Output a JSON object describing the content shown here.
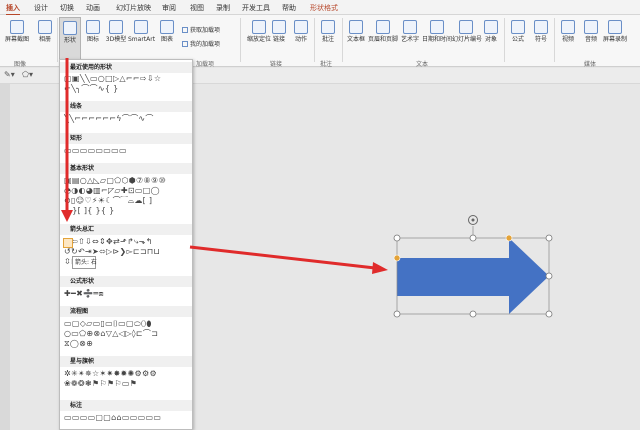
{
  "tabs": [
    "插入",
    "设计",
    "切换",
    "动画",
    "幻灯片放映",
    "审阅",
    "视图",
    "录制",
    "开发工具",
    "帮助",
    "形状格式"
  ],
  "ribbon": {
    "buttons": [
      {
        "label": "屏幕截图"
      },
      {
        "label": "相册"
      },
      {
        "label": "形状"
      },
      {
        "label": "图标"
      },
      {
        "label": "3D模型"
      },
      {
        "label": "SmartArt"
      },
      {
        "label": "图表"
      },
      {
        "label": "缩放定位"
      },
      {
        "label": "链接"
      },
      {
        "label": "动作"
      },
      {
        "label": "批注"
      },
      {
        "label": "文本框"
      },
      {
        "label": "页眉和页脚"
      },
      {
        "label": "艺术字"
      },
      {
        "label": "日期和时间"
      },
      {
        "label": "幻灯片编号"
      },
      {
        "label": "对象"
      },
      {
        "label": "公式"
      },
      {
        "label": "符号"
      },
      {
        "label": "视频"
      },
      {
        "label": "音频"
      },
      {
        "label": "屏幕录制"
      }
    ],
    "small": {
      "get_addins": "获取加载项",
      "my_addins": "我的加载项"
    },
    "groups": {
      "images": "图像",
      "addins": "加载项",
      "links": "链接",
      "comments": "批注",
      "text": "文本",
      "media": "媒体"
    }
  },
  "menu": {
    "sections": {
      "recent": "最近使用的形状",
      "lines": "线条",
      "rect": "矩形",
      "basic": "基本形状",
      "arrows": "箭头总汇",
      "equation": "公式形状",
      "flowchart": "流程图",
      "stars": "星与旗帜",
      "callouts": "标注"
    },
    "rows": {
      "recent1": "▢▣╲╲▭○□▷△⌐⌐⇨⇩☆",
      "recent2": "⌐╲╮⌒⌒∿{ }",
      "lines": "╲╲⌐⌐⌐⌐⌐⌐ϟ⌒⌒∿⌒",
      "rect": "▭▭▭▭▭▭▭▭",
      "basic1": "▣▤○△◺▱▢⬠⬡⬢⑦⑧⑨⑩",
      "basic2": "◔◑◐◕▥⌐◸▱✚⊡▭□◯",
      "basic3": "⊘▯☺♡⚡☀☾⌒⁀⌓☁[ ]",
      "basic4": "{ }[ ]{ }{ }",
      "arrows1": "⇨⇦⇧⇩⇔⇕✥⇄⬏↱⤷⬎↰",
      "arrows2": "↺↻↶⇥➤⬄▷⊳❯▻⊏⊐⊓⊔",
      "arrows3": "⇳⊠",
      "equation": "✚━✖➗═⧈",
      "flow1": "▭▢◇▱▭▯▭⌷▭▢⬭⬯⬮",
      "flow2": "○▭⬠⊕⊗⌂▽△◁▷◊⊏⌒⊐",
      "flow3": "⧖◯⊗⊕",
      "stars1": "✲✳✴✵☆✶✷✸✹✺⚙⚙⚙",
      "stars2": "❀❁❂❃⚑⚐⚑⚐▭⚑",
      "callouts": "▭▭▭▭▢▢⌂⌂▭▭▭▭▭"
    },
    "tooltip": "箭头: 右"
  },
  "shape": {
    "fill": "#4472c4",
    "type": "right-arrow"
  },
  "accent": {
    "tab": "#b7472a",
    "arrow": "#e02b2b",
    "handle": "#e3a33a"
  }
}
